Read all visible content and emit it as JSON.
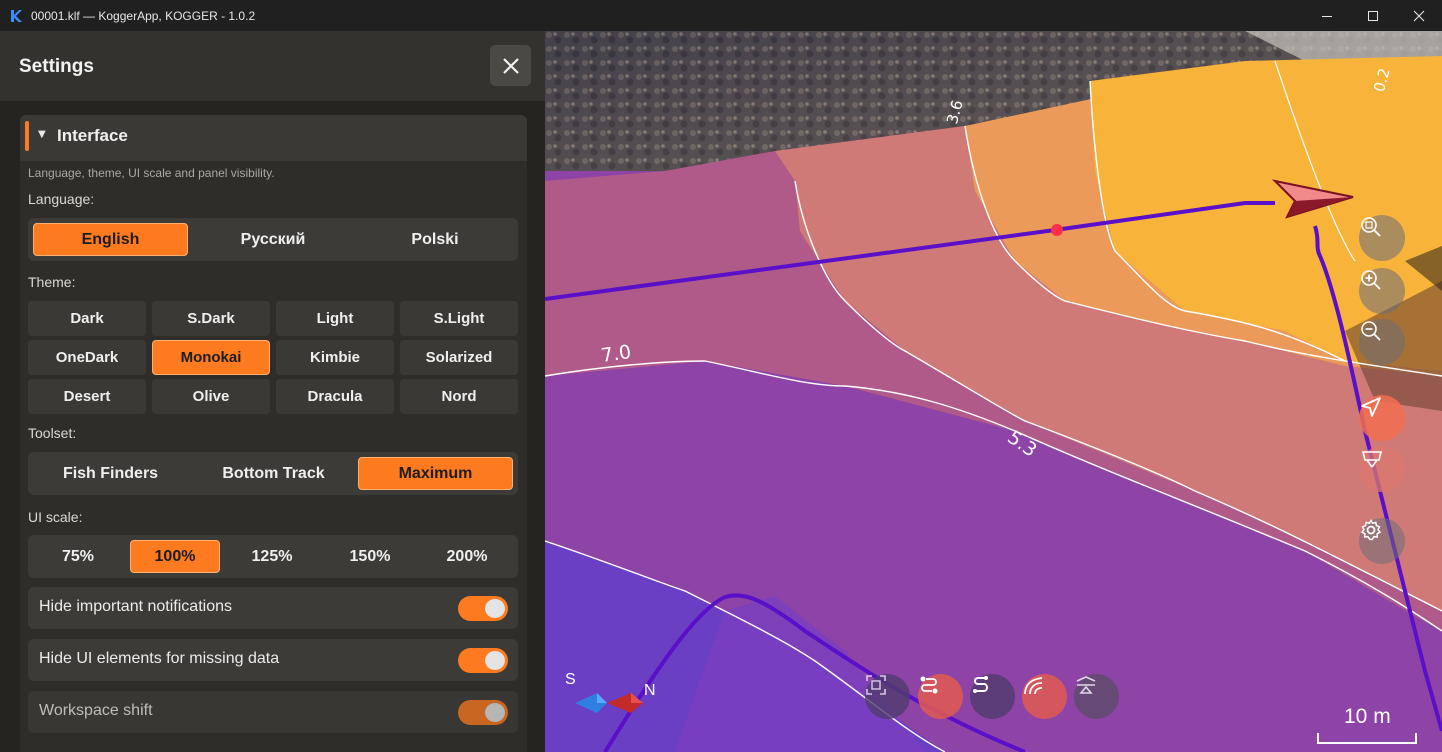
{
  "window": {
    "title": "00001.klf — KoggerApp, KOGGER - 1.0.2",
    "controls": [
      "minimize-icon",
      "maximize-icon",
      "close-icon"
    ]
  },
  "settings": {
    "title": "Settings",
    "section": {
      "title": "Interface",
      "description": "Language, theme, UI scale and panel visibility.",
      "language": {
        "label": "Language:",
        "options": [
          "English",
          "Русский",
          "Polski"
        ],
        "selected": "English"
      },
      "theme": {
        "label": "Theme:",
        "options": [
          "Dark",
          "S.Dark",
          "Light",
          "S.Light",
          "OneDark",
          "Monokai",
          "Kimbie",
          "Solarized",
          "Desert",
          "Olive",
          "Dracula",
          "Nord"
        ],
        "selected": "Monokai"
      },
      "toolset": {
        "label": "Toolset:",
        "options": [
          "Fish Finders",
          "Bottom Track",
          "Maximum"
        ],
        "selected": "Maximum"
      },
      "ui_scale": {
        "label": "UI scale:",
        "options": [
          "75%",
          "100%",
          "125%",
          "150%",
          "200%"
        ],
        "selected": "100%"
      },
      "toggles": [
        {
          "label": "Hide important notifications",
          "on": true
        },
        {
          "label": "Hide UI elements for missing data",
          "on": true
        },
        {
          "label": "Workspace shift",
          "on": true
        }
      ]
    }
  },
  "scene": {
    "contour_labels": [
      "7.0",
      "5.3",
      "3.6",
      "0.2"
    ],
    "compass": {
      "south": "S",
      "north": "N"
    },
    "scale": "10 m",
    "right_buttons": [
      "zoom-fit-icon",
      "zoom-in-icon",
      "zoom-out-icon",
      "navigate-arrow-icon",
      "vehicle-icon",
      "settings-gear-icon"
    ],
    "bottom_tools": [
      "select-frame-icon",
      "route-icon",
      "track-icon",
      "sonar-icon",
      "layers-icon"
    ],
    "colors": {
      "accent": "#fd7a1f",
      "track": "#5a10c8"
    }
  }
}
